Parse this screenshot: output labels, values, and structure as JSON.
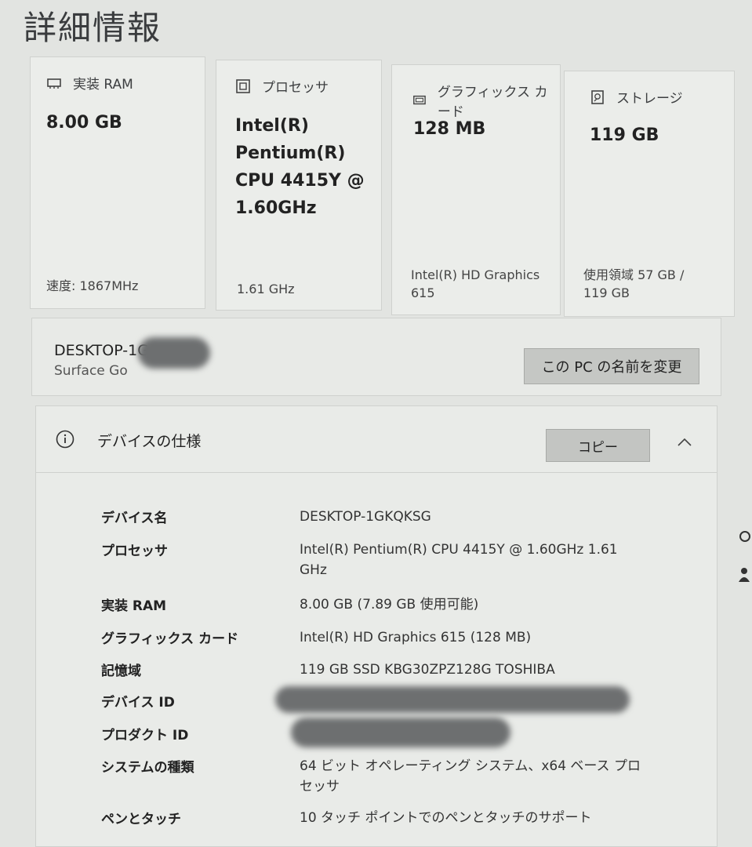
{
  "page_title": "詳細情報",
  "cards": [
    {
      "label": "実装 RAM",
      "value": "8.00 GB",
      "sub": "速度: 1867MHz",
      "icon": "ram-icon"
    },
    {
      "label": "プロセッサ",
      "value": "Intel(R) Pentium(R) CPU 4415Y @ 1.60GHz",
      "sub": "1.61 GHz",
      "icon": "processor-icon"
    },
    {
      "label": "グラフィックス カード",
      "value": "128 MB",
      "sub": "Intel(R) HD Graphics 615",
      "icon": "graphics-card-icon"
    },
    {
      "label": "ストレージ",
      "value": "119 GB",
      "sub": "使用領域 57 GB / 119 GB",
      "icon": "storage-icon"
    }
  ],
  "pc": {
    "name": "DESKTOP-1G",
    "model": "Surface Go",
    "rename_label": "この PC の名前を変更"
  },
  "specs": {
    "title": "デバイスの仕様",
    "copy_label": "コピー",
    "rows": [
      {
        "label": "デバイス名",
        "value": "DESKTOP-1GKQKSG"
      },
      {
        "label": "プロセッサ",
        "value": "Intel(R) Pentium(R) CPU 4415Y @ 1.60GHz   1.61 GHz"
      },
      {
        "label": "実装 RAM",
        "value": "8.00 GB (7.89 GB 使用可能)"
      },
      {
        "label": "グラフィックス カード",
        "value": "Intel(R) HD Graphics 615 (128 MB)"
      },
      {
        "label": "記憶域",
        "value": "119 GB SSD KBG30ZPZ128G TOSHIBA"
      },
      {
        "label": "デバイス ID",
        "value": ""
      },
      {
        "label": "プロダクト ID",
        "value": ""
      },
      {
        "label": "システムの種類",
        "value": "64 ビット オペレーティング システム、x64 ベース プロセッサ"
      },
      {
        "label": "ペンとタッチ",
        "value": "10 タッチ ポイントでのペンとタッチのサポート"
      }
    ]
  }
}
